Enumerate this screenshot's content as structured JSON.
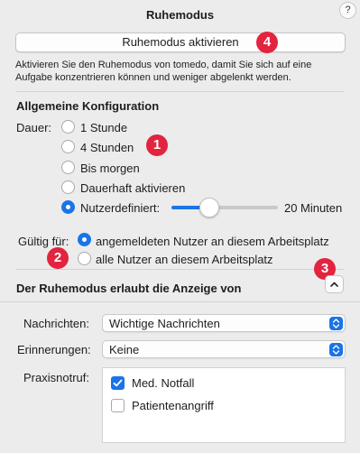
{
  "window": {
    "title": "Ruhemodus",
    "help_label": "?"
  },
  "activate_button": {
    "label": "Ruhemodus aktivieren"
  },
  "description": "Aktivieren Sie den Ruhemodus von tomedo, damit Sie sich auf eine Aufgabe konzentrieren können und weniger abgelenkt werden.",
  "general_config": {
    "title": "Allgemeine Konfiguration",
    "duration_label": "Dauer:",
    "options": [
      {
        "label": "1 Stunde",
        "selected": false
      },
      {
        "label": "4 Stunden",
        "selected": false
      },
      {
        "label": "Bis morgen",
        "selected": false
      },
      {
        "label": "Dauerhaft aktivieren",
        "selected": false
      },
      {
        "label": "Nutzerdefiniert:",
        "selected": true
      }
    ],
    "slider": {
      "value": 20,
      "value_text": "20",
      "unit": "Minuten"
    }
  },
  "validity": {
    "label": "Gültig für:",
    "options": [
      {
        "label": "angemeldeten Nutzer an diesem Arbeitsplatz",
        "selected": true
      },
      {
        "label": "alle Nutzer an diesem Arbeitsplatz",
        "selected": false
      }
    ]
  },
  "allow_section": {
    "title": "Der Ruhemodus erlaubt die Anzeige von",
    "disclosure": "chevron-up-icon"
  },
  "messages": {
    "label": "Nachrichten:",
    "value": "Wichtige Nachrichten"
  },
  "reminders": {
    "label": "Erinnerungen:",
    "value": "Keine"
  },
  "practice_call": {
    "label": "Praxisnotruf:",
    "items": [
      {
        "label": "Med. Notfall",
        "checked": true
      },
      {
        "label": "Patientenangriff",
        "checked": false
      }
    ]
  },
  "markers": [
    "1",
    "2",
    "3",
    "4"
  ],
  "colors": {
    "accent": "#1a74e8",
    "marker": "#e2243f",
    "background": "#ececec"
  }
}
